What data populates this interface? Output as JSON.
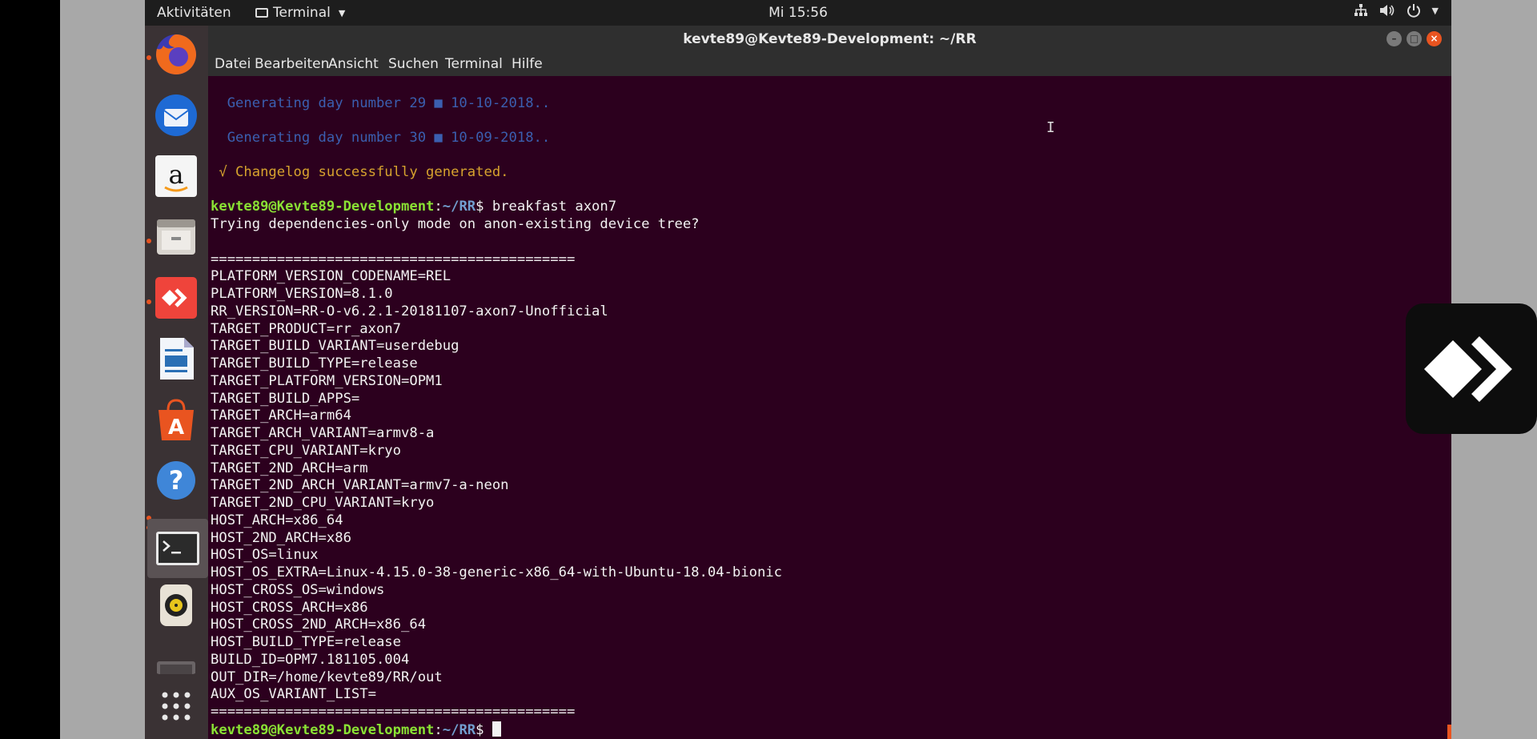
{
  "topbar": {
    "activities": "Aktivitäten",
    "app_name": "Terminal",
    "clock": "Mi 15:56",
    "tray_icons": [
      "network-icon",
      "volume-icon",
      "power-icon",
      "chevron-down-icon"
    ]
  },
  "dock": {
    "items": [
      "firefox-icon",
      "thunderbird-icon",
      "amazon-icon",
      "files-icon",
      "anydesk-icon",
      "writer-icon",
      "software-icon",
      "help-icon",
      "terminal-icon",
      "rhythmbox-icon",
      "partial-app-icon",
      "app-grid-icon"
    ]
  },
  "window": {
    "title": "kevte89@Kevte89-Development: ~/RR",
    "menu": [
      "Datei",
      "Bearbeiten",
      "Ansicht",
      "Suchen",
      "Terminal",
      "Hilfe"
    ]
  },
  "terminal": {
    "gen29": "  Generating day number 29 ■ 10-10-2018..",
    "gen30": "  Generating day number 30 ■ 10-09-2018..",
    "changelog": " √ Changelog successfully generated.",
    "prompt_user": "kevte89@Kevte89-Development",
    "prompt_path": "~/RR",
    "prompt_sym": "$",
    "command": " breakfast axon7",
    "lines": [
      "Trying dependencies-only mode on anon-existing device tree?",
      "",
      "============================================",
      "PLATFORM_VERSION_CODENAME=REL",
      "PLATFORM_VERSION=8.1.0",
      "RR_VERSION=RR-O-v6.2.1-20181107-axon7-Unofficial",
      "TARGET_PRODUCT=rr_axon7",
      "TARGET_BUILD_VARIANT=userdebug",
      "TARGET_BUILD_TYPE=release",
      "TARGET_PLATFORM_VERSION=OPM1",
      "TARGET_BUILD_APPS=",
      "TARGET_ARCH=arm64",
      "TARGET_ARCH_VARIANT=armv8-a",
      "TARGET_CPU_VARIANT=kryo",
      "TARGET_2ND_ARCH=arm",
      "TARGET_2ND_ARCH_VARIANT=armv7-a-neon",
      "TARGET_2ND_CPU_VARIANT=kryo",
      "HOST_ARCH=x86_64",
      "HOST_2ND_ARCH=x86",
      "HOST_OS=linux",
      "HOST_OS_EXTRA=Linux-4.15.0-38-generic-x86_64-with-Ubuntu-18.04-bionic",
      "HOST_CROSS_OS=windows",
      "HOST_CROSS_ARCH=x86",
      "HOST_CROSS_2ND_ARCH=x86_64",
      "HOST_BUILD_TYPE=release",
      "BUILD_ID=OPM7.181105.004",
      "OUT_DIR=/home/kevte89/RR/out",
      "AUX_OS_VARIANT_LIST=",
      "============================================"
    ]
  },
  "overlay": {
    "icon": "anydesk-icon"
  }
}
